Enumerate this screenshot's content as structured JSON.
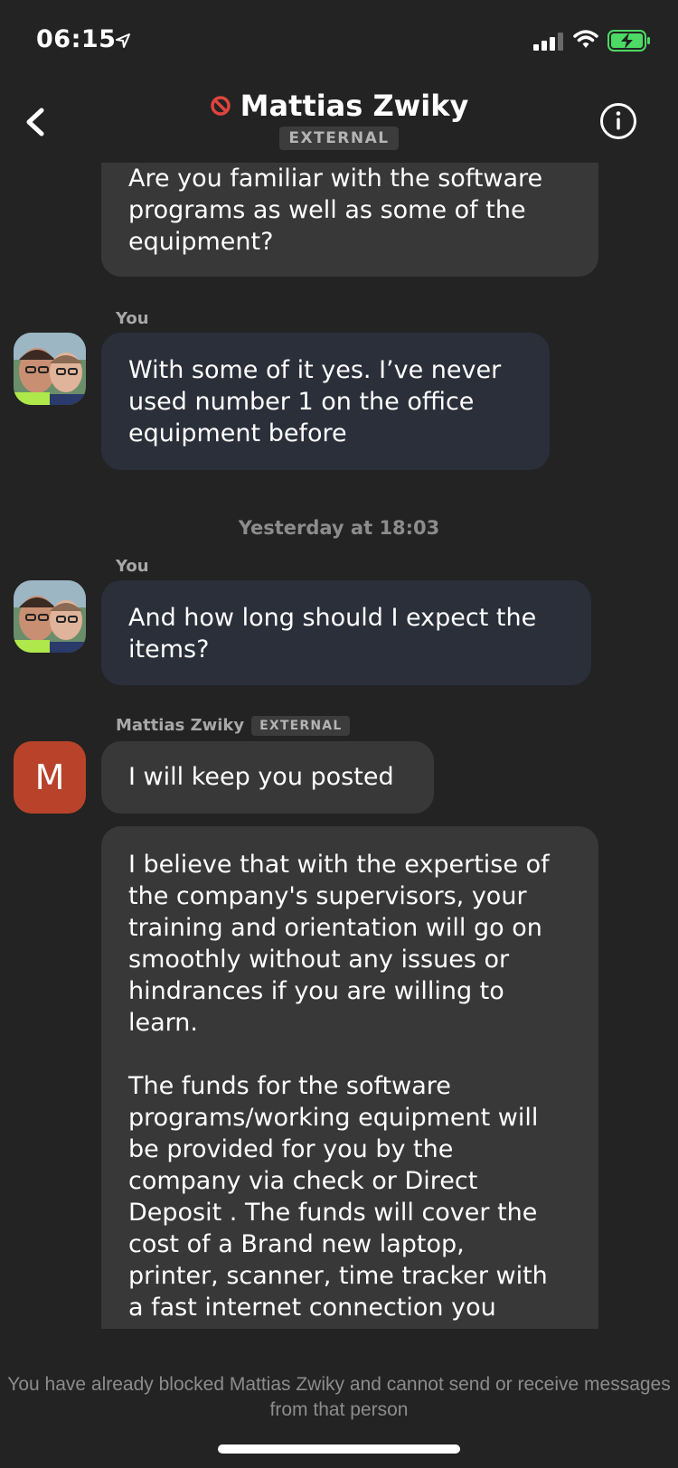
{
  "status_bar": {
    "time": "06:15"
  },
  "header": {
    "contact_name": "Mattias Zwiky",
    "badge": "EXTERNAL"
  },
  "messages": [
    {
      "sender": "",
      "text": "Are you familiar with the software\nprograms as well as some of the\nequipment?"
    },
    {
      "sender": "You",
      "text": "With some of it yes. I’ve never\nused number 1 on the office\nequipment before"
    },
    {
      "timestamp": "Yesterday at 18:03"
    },
    {
      "sender": "You",
      "text": "And how long should I expect the\nitems?"
    },
    {
      "sender": "Mattias Zwiky",
      "badge": "EXTERNAL",
      "avatar_letter": "M",
      "text": "I will keep you posted"
    },
    {
      "sender": "",
      "text": "I believe that with the expertise of\nthe company's supervisors, your\ntraining and orientation will go on\nsmoothly without any issues or\nhindrances if you are willing to\nlearn.\n\nThe funds for the software\nprograms/working equipment will\nbe provided for you by the\ncompany via check or Direct\nDeposit . The funds will cover the\ncost of a Brand new laptop,\nprinter, scanner, time tracker with\na fast internet connection you"
    }
  ],
  "footer": {
    "blocked_notice": "You have already blocked Mattias Zwiky and cannot send or receive messages from that person"
  },
  "colors": {
    "background": "#232323",
    "incoming_bubble": "#383838",
    "outgoing_bubble": "#2a2f3a",
    "avatar_m": "#b8432a",
    "blocked_icon": "#e0443c",
    "battery_charging": "#4cd964"
  },
  "icons": {
    "back": "chevron-left-icon",
    "info": "info-circle-icon",
    "blocked": "blocked-icon",
    "location": "location-arrow-icon",
    "signal": "signal-icon",
    "wifi": "wifi-icon",
    "battery": "battery-charging-icon"
  }
}
